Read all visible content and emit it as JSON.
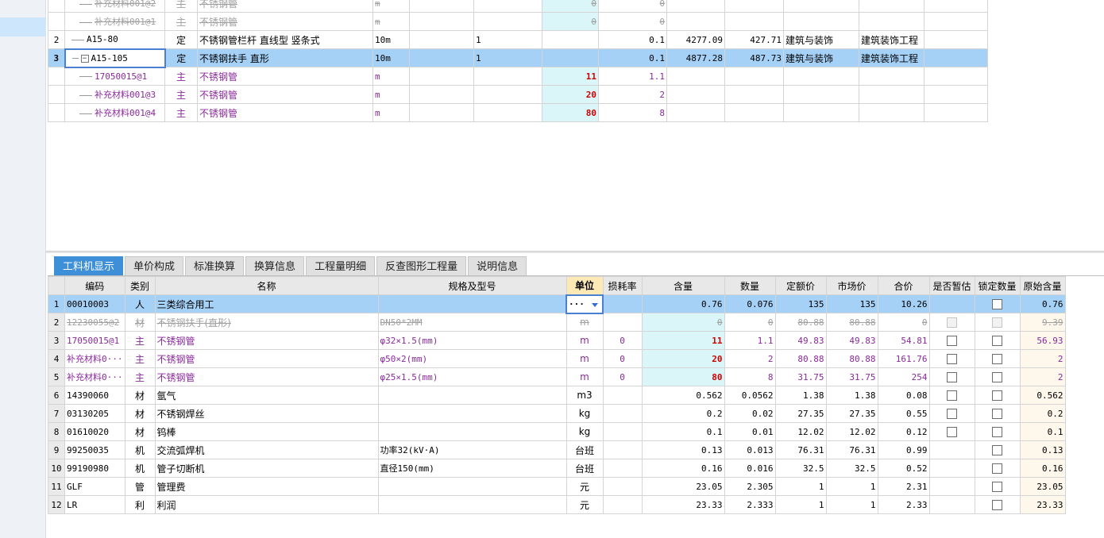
{
  "top_grid": {
    "rows": [
      {
        "num": "",
        "code": "补充材料001@2",
        "type": "主",
        "name": "不锈钢管",
        "unit": "m",
        "c5": "",
        "c6": "",
        "content": "0",
        "qty": "0",
        "c9": "",
        "c10": "",
        "c11": "",
        "c12": ""
      },
      {
        "num": "",
        "code": "补充材料001@1",
        "type": "主",
        "name": "不锈钢管",
        "unit": "m",
        "c5": "",
        "c6": "",
        "content": "0",
        "qty": "0",
        "c9": "",
        "c10": "",
        "c11": "",
        "c12": ""
      },
      {
        "num": "2",
        "code": "A15-80",
        "type": "定",
        "name": "不锈钢管栏杆 直线型 竖条式",
        "unit": "10m",
        "c5": "",
        "c6": "1",
        "content": "",
        "qty": "0.1",
        "c9": "4277.09",
        "c10": "427.71",
        "c11": "建筑与装饰",
        "c12": "建筑装饰工程"
      },
      {
        "num": "3",
        "code": "A15-105",
        "type": "定",
        "name": "不锈钢扶手 直形",
        "unit": "10m",
        "c5": "",
        "c6": "1",
        "content": "",
        "qty": "0.1",
        "c9": "4877.28",
        "c10": "487.73",
        "c11": "建筑与装饰",
        "c12": "建筑装饰工程"
      },
      {
        "num": "",
        "code": "17050015@1",
        "type": "主",
        "name": "不锈钢管",
        "unit": "m",
        "c5": "",
        "c6": "",
        "content": "11",
        "qty": "1.1",
        "c9": "",
        "c10": "",
        "c11": "",
        "c12": ""
      },
      {
        "num": "",
        "code": "补充材料001@3",
        "type": "主",
        "name": "不锈钢管",
        "unit": "m",
        "c5": "",
        "c6": "",
        "content": "20",
        "qty": "2",
        "c9": "",
        "c10": "",
        "c11": "",
        "c12": ""
      },
      {
        "num": "",
        "code": "补充材料001@4",
        "type": "主",
        "name": "不锈钢管",
        "unit": "m",
        "c5": "",
        "c6": "",
        "content": "80",
        "qty": "8",
        "c9": "",
        "c10": "",
        "c11": "",
        "c12": ""
      }
    ]
  },
  "tabs": [
    "工料机显示",
    "单价构成",
    "标准换算",
    "换算信息",
    "工程量明细",
    "反查图形工程量",
    "说明信息"
  ],
  "bottom_grid": {
    "headers": [
      "",
      "编码",
      "类别",
      "名称",
      "规格及型号",
      "单位",
      "损耗率",
      "含量",
      "数量",
      "定额价",
      "市场价",
      "合价",
      "是否暂估",
      "锁定数量",
      "原始含量"
    ],
    "rows": [
      {
        "n": "1",
        "code": "00010003",
        "type": "人",
        "name": "三类综合用工",
        "spec": "",
        "unit": "···",
        "loss": "",
        "content": "0.76",
        "qty": "0.076",
        "quota": "135",
        "market": "135",
        "total": "10.26",
        "est": false,
        "lock": true,
        "orig": "0.76"
      },
      {
        "n": "2",
        "code": "12230055@2",
        "type": "材",
        "name": "不锈钢扶手(直形)",
        "spec": "DN50*2MM",
        "unit": "m",
        "loss": "",
        "content": "0",
        "qty": "0",
        "quota": "80.88",
        "market": "80.88",
        "total": "0",
        "est": true,
        "lock": true,
        "orig": "9.39"
      },
      {
        "n": "3",
        "code": "17050015@1",
        "type": "主",
        "name": "不锈钢管",
        "spec": "φ32×1.5(mm)",
        "unit": "m",
        "loss": "0",
        "content": "11",
        "qty": "1.1",
        "quota": "49.83",
        "market": "49.83",
        "total": "54.81",
        "est": true,
        "lock": true,
        "orig": "56.93"
      },
      {
        "n": "4",
        "code": "补充材料0···",
        "type": "主",
        "name": "不锈钢管",
        "spec": "φ50×2(mm)",
        "unit": "m",
        "loss": "0",
        "content": "20",
        "qty": "2",
        "quota": "80.88",
        "market": "80.88",
        "total": "161.76",
        "est": true,
        "lock": true,
        "orig": "2"
      },
      {
        "n": "5",
        "code": "补充材料0···",
        "type": "主",
        "name": "不锈钢管",
        "spec": "φ25×1.5(mm)",
        "unit": "m",
        "loss": "0",
        "content": "80",
        "qty": "8",
        "quota": "31.75",
        "market": "31.75",
        "total": "254",
        "est": true,
        "lock": true,
        "orig": "2"
      },
      {
        "n": "6",
        "code": "14390060",
        "type": "材",
        "name": "氩气",
        "spec": "",
        "unit": "m3",
        "loss": "",
        "content": "0.562",
        "qty": "0.0562",
        "quota": "1.38",
        "market": "1.38",
        "total": "0.08",
        "est": true,
        "lock": true,
        "orig": "0.562"
      },
      {
        "n": "7",
        "code": "03130205",
        "type": "材",
        "name": "不锈钢焊丝",
        "spec": "",
        "unit": "kg",
        "loss": "",
        "content": "0.2",
        "qty": "0.02",
        "quota": "27.35",
        "market": "27.35",
        "total": "0.55",
        "est": true,
        "lock": true,
        "orig": "0.2"
      },
      {
        "n": "8",
        "code": "01610020",
        "type": "材",
        "name": "钨棒",
        "spec": "",
        "unit": "kg",
        "loss": "",
        "content": "0.1",
        "qty": "0.01",
        "quota": "12.02",
        "market": "12.02",
        "total": "0.12",
        "est": true,
        "lock": true,
        "orig": "0.1"
      },
      {
        "n": "9",
        "code": "99250035",
        "type": "机",
        "name": "交流弧焊机",
        "spec": "功率32(kV·A)",
        "unit": "台班",
        "loss": "",
        "content": "0.13",
        "qty": "0.013",
        "quota": "76.31",
        "market": "76.31",
        "total": "0.99",
        "est": false,
        "lock": true,
        "orig": "0.13"
      },
      {
        "n": "10",
        "code": "99190980",
        "type": "机",
        "name": "管子切断机",
        "spec": "直径150(mm)",
        "unit": "台班",
        "loss": "",
        "content": "0.16",
        "qty": "0.016",
        "quota": "32.5",
        "market": "32.5",
        "total": "0.52",
        "est": false,
        "lock": true,
        "orig": "0.16"
      },
      {
        "n": "11",
        "code": "GLF",
        "type": "管",
        "name": "管理费",
        "spec": "",
        "unit": "元",
        "loss": "",
        "content": "23.05",
        "qty": "2.305",
        "quota": "1",
        "market": "1",
        "total": "2.31",
        "est": false,
        "lock": true,
        "orig": "23.05"
      },
      {
        "n": "12",
        "code": "LR",
        "type": "利",
        "name": "利润",
        "spec": "",
        "unit": "元",
        "loss": "",
        "content": "23.33",
        "qty": "2.333",
        "quota": "1",
        "market": "1",
        "total": "2.33",
        "est": false,
        "lock": true,
        "orig": "23.33"
      }
    ]
  }
}
